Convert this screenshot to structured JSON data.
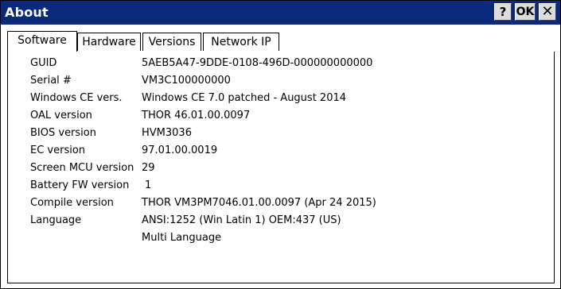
{
  "window": {
    "title": "About",
    "help_label": "?",
    "ok_label": "OK",
    "close_label": "✕"
  },
  "tabs": [
    {
      "label": "Software",
      "active": true
    },
    {
      "label": "Hardware",
      "active": false
    },
    {
      "label": "Versions",
      "active": false
    },
    {
      "label": "Network IP",
      "active": false
    }
  ],
  "info": [
    {
      "label": "GUID",
      "value": "5AEB5A47-9DDE-0108-496D-000000000000"
    },
    {
      "label": "Serial #",
      "value": "VM3C100000000"
    },
    {
      "label": "Windows CE vers.",
      "value": "Windows CE 7.0 patched - August 2014"
    },
    {
      "label": "OAL version",
      "value": "THOR  46.01.00.0097"
    },
    {
      "label": "BIOS version",
      "value": "HVM3036"
    },
    {
      "label": "EC version",
      "value": "97.01.00.0019"
    },
    {
      "label": "Screen MCU version",
      "value": "29"
    },
    {
      "label": "Battery FW version",
      "value": "1"
    },
    {
      "label": "Compile version",
      "value": "THOR  VM3PM7046.01.00.0097 (Apr 24 2015)"
    },
    {
      "label": "Language",
      "value": "ANSI:1252 (Win Latin 1) OEM:437 (US)"
    }
  ],
  "language_extra": "Multi Language",
  "colors": {
    "titlebar": "#0b2a7c",
    "button_face": "#dcdcdc"
  }
}
